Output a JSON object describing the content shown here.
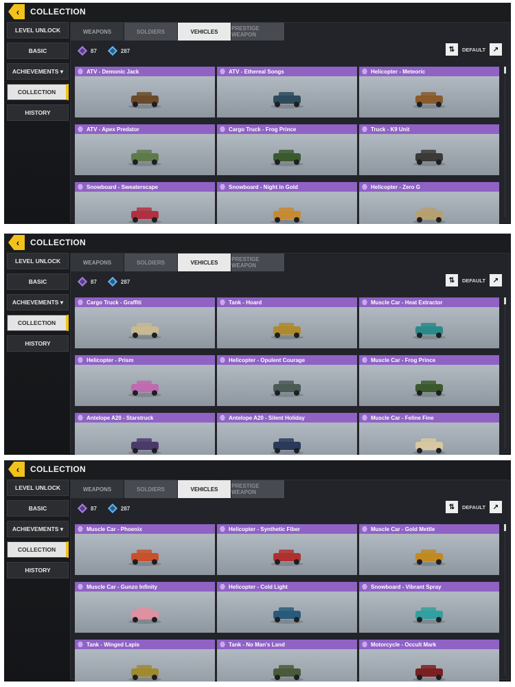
{
  "panels": [
    {
      "title": "COLLECTION",
      "sidebar": [
        "LEVEL UNLOCK",
        "BASIC",
        "ACHIEVEMENTS ▾",
        "COLLECTION",
        "HISTORY"
      ],
      "tabs": [
        "WEAPONS",
        "SOLDIERS",
        "VEHICLES",
        "PRESTIGE WEAPON"
      ],
      "currency": {
        "purple": "87",
        "blue": "287"
      },
      "sort_label": "DEFAULT",
      "cards": [
        {
          "name": "ATV - Demonic Jack",
          "color": "#6b4a2a"
        },
        {
          "name": "ATV -  Ethereal Songs",
          "color": "#2c4a5c"
        },
        {
          "name": "Helicopter - Meteoric",
          "color": "#8a5a2a"
        },
        {
          "name": "ATV - Apex Predator",
          "color": "#5f7a4a"
        },
        {
          "name": "Cargo Truck - Frog Prince",
          "color": "#3a5a2e"
        },
        {
          "name": "Truck - K9 Unit",
          "color": "#3a3a36"
        },
        {
          "name": "Snowboard - Sweaterscape",
          "color": "#b03040"
        },
        {
          "name": "Snowboard - Night in Gold",
          "color": "#c88a30"
        },
        {
          "name": "Helicopter - Zero G",
          "color": "#b7a070"
        }
      ]
    },
    {
      "title": "COLLECTION",
      "sidebar": [
        "LEVEL UNLOCK",
        "BASIC",
        "ACHIEVEMENTS ▾",
        "COLLECTION",
        "HISTORY"
      ],
      "tabs": [
        "WEAPONS",
        "SOLDIERS",
        "VEHICLES",
        "PRESTIGE WEAPON"
      ],
      "currency": {
        "purple": "87",
        "blue": "287"
      },
      "sort_label": "DEFAULT",
      "cards": [
        {
          "name": "Cargo Truck - Graffiti",
          "color": "#c9b890"
        },
        {
          "name": "Tank - Hoard",
          "color": "#b08a2a"
        },
        {
          "name": "Muscle Car - Heat Extractor",
          "color": "#2a8a8a"
        },
        {
          "name": "Helicopter - Prism",
          "color": "#c06ab0"
        },
        {
          "name": "Helicopter - Opulent Courage",
          "color": "#4a5a55"
        },
        {
          "name": "Muscle Car - Frog Prince",
          "color": "#3a5a2e"
        },
        {
          "name": "Antelope A20 - Starstruck",
          "color": "#4a3a6a"
        },
        {
          "name": "Antelope A20 -  Silent Holiday",
          "color": "#2a3a5a"
        },
        {
          "name": "Muscle Car - Feline Fine",
          "color": "#d8c8a0"
        }
      ]
    },
    {
      "title": "COLLECTION",
      "sidebar": [
        "LEVEL UNLOCK",
        "BASIC",
        "ACHIEVEMENTS ▾",
        "COLLECTION",
        "HISTORY"
      ],
      "tabs": [
        "WEAPONS",
        "SOLDIERS",
        "VEHICLES",
        "PRESTIGE WEAPON"
      ],
      "currency": {
        "purple": "87",
        "blue": "287"
      },
      "sort_label": "DEFAULT",
      "cards": [
        {
          "name": "Muscle Car - Phoenix",
          "color": "#c8502a"
        },
        {
          "name": "Helicopter - Synthetic Fiber",
          "color": "#b03030"
        },
        {
          "name": "Muscle Car - Gold Mettle",
          "color": "#c08a20"
        },
        {
          "name": "Muscle Car - Gunzo Infinity",
          "color": "#e090a0"
        },
        {
          "name": "Helicopter - Cold Light",
          "color": "#2a5a7a"
        },
        {
          "name": "Snowboard - Vibrant Spray",
          "color": "#30a0a0"
        },
        {
          "name": "Tank - Winged Lapis",
          "color": "#a08a30"
        },
        {
          "name": "Tank - No Man's Land",
          "color": "#4a5a3a"
        },
        {
          "name": "Motorcycle - Occult Mark",
          "color": "#7a2020"
        }
      ]
    }
  ]
}
